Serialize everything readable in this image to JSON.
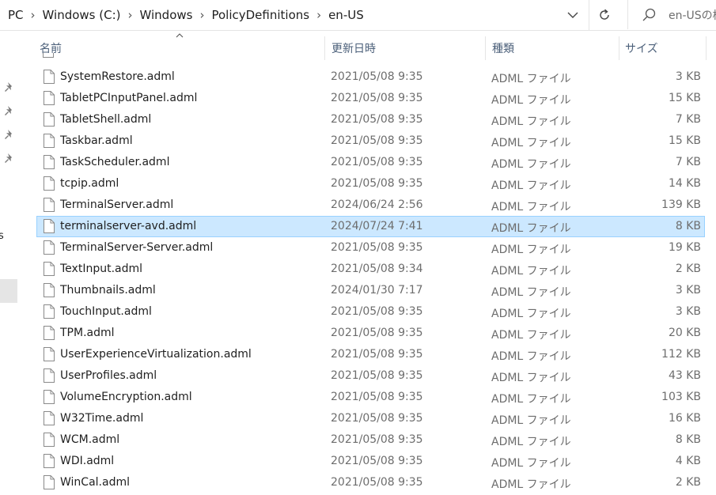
{
  "address_bar": {
    "breadcrumbs": [
      "PC",
      "Windows (C:)",
      "Windows",
      "PolicyDefinitions",
      "en-US"
    ],
    "search_placeholder": "en-USの検"
  },
  "columns": {
    "name": "名前",
    "date": "更新日時",
    "type": "種類",
    "size": "サイズ"
  },
  "nav_pane": {
    "partial_label": "s"
  },
  "files": [
    {
      "name": "SystemRestore.adml",
      "date": "2021/05/08 9:35",
      "type": "ADML ファイル",
      "size": "3 KB"
    },
    {
      "name": "TabletPCInputPanel.adml",
      "date": "2021/05/08 9:35",
      "type": "ADML ファイル",
      "size": "15 KB"
    },
    {
      "name": "TabletShell.adml",
      "date": "2021/05/08 9:35",
      "type": "ADML ファイル",
      "size": "7 KB"
    },
    {
      "name": "Taskbar.adml",
      "date": "2021/05/08 9:35",
      "type": "ADML ファイル",
      "size": "15 KB"
    },
    {
      "name": "TaskScheduler.adml",
      "date": "2021/05/08 9:35",
      "type": "ADML ファイル",
      "size": "7 KB"
    },
    {
      "name": "tcpip.adml",
      "date": "2021/05/08 9:35",
      "type": "ADML ファイル",
      "size": "14 KB"
    },
    {
      "name": "TerminalServer.adml",
      "date": "2024/06/24 2:56",
      "type": "ADML ファイル",
      "size": "139 KB"
    },
    {
      "name": "terminalserver-avd.adml",
      "date": "2024/07/24 7:41",
      "type": "ADML ファイル",
      "size": "8 KB",
      "selected": true
    },
    {
      "name": "TerminalServer-Server.adml",
      "date": "2021/05/08 9:35",
      "type": "ADML ファイル",
      "size": "19 KB"
    },
    {
      "name": "TextInput.adml",
      "date": "2021/05/08 9:34",
      "type": "ADML ファイル",
      "size": "2 KB"
    },
    {
      "name": "Thumbnails.adml",
      "date": "2024/01/30 7:17",
      "type": "ADML ファイル",
      "size": "3 KB"
    },
    {
      "name": "TouchInput.adml",
      "date": "2021/05/08 9:35",
      "type": "ADML ファイル",
      "size": "3 KB"
    },
    {
      "name": "TPM.adml",
      "date": "2021/05/08 9:35",
      "type": "ADML ファイル",
      "size": "20 KB"
    },
    {
      "name": "UserExperienceVirtualization.adml",
      "date": "2021/05/08 9:35",
      "type": "ADML ファイル",
      "size": "112 KB"
    },
    {
      "name": "UserProfiles.adml",
      "date": "2021/05/08 9:35",
      "type": "ADML ファイル",
      "size": "43 KB"
    },
    {
      "name": "VolumeEncryption.adml",
      "date": "2021/05/08 9:35",
      "type": "ADML ファイル",
      "size": "103 KB"
    },
    {
      "name": "W32Time.adml",
      "date": "2021/05/08 9:35",
      "type": "ADML ファイル",
      "size": "16 KB"
    },
    {
      "name": "WCM.adml",
      "date": "2021/05/08 9:35",
      "type": "ADML ファイル",
      "size": "8 KB"
    },
    {
      "name": "WDI.adml",
      "date": "2021/05/08 9:35",
      "type": "ADML ファイル",
      "size": "4 KB"
    },
    {
      "name": "WinCal.adml",
      "date": "2021/05/08 9:35",
      "type": "ADML ファイル",
      "size": "2 KB"
    }
  ]
}
